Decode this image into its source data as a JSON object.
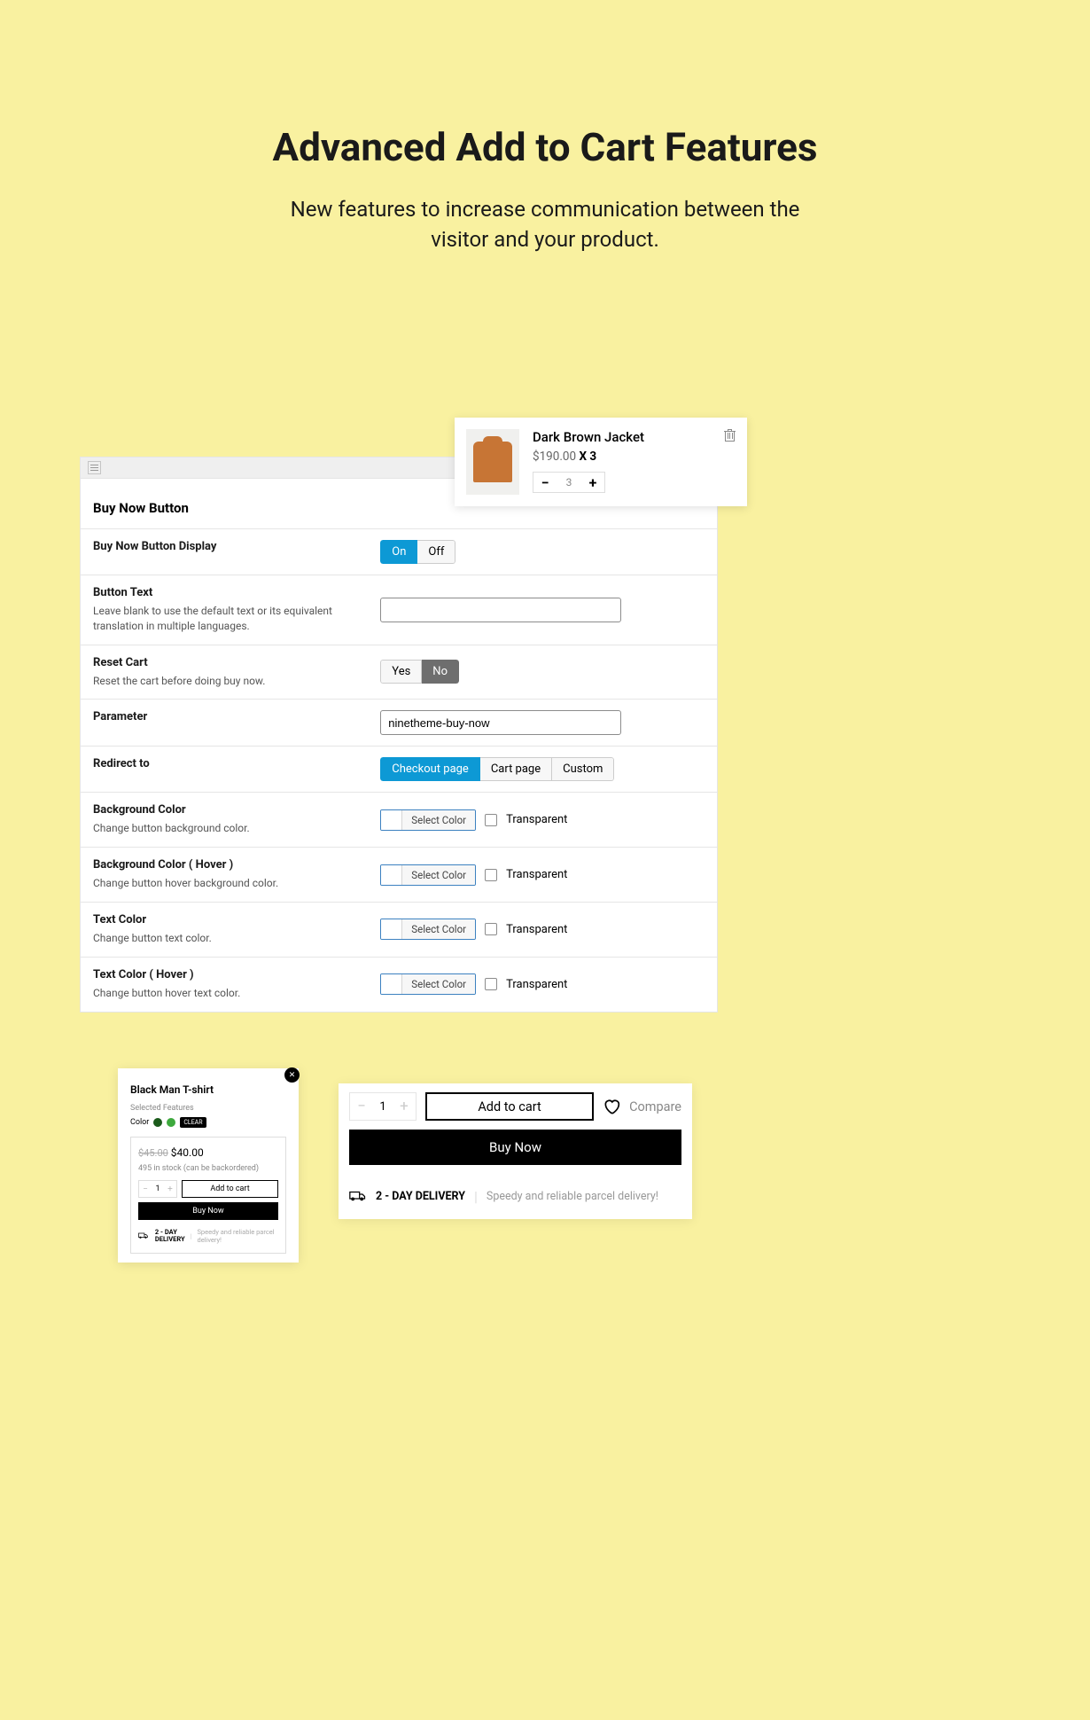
{
  "hero": {
    "title": "Advanced Add to Cart Features",
    "subtitle_l1": "New features to increase communication between the",
    "subtitle_l2": "visitor and your product."
  },
  "settings": {
    "section_title": "Buy Now Button",
    "display": {
      "label": "Buy Now Button Display",
      "on": "On",
      "off": "Off"
    },
    "button_text": {
      "label": "Button Text",
      "help": "Leave blank to use the default text or its equivalent translation in multiple languages.",
      "value": ""
    },
    "reset_cart": {
      "label": "Reset Cart",
      "help": "Reset the cart before doing buy now.",
      "yes": "Yes",
      "no": "No"
    },
    "parameter": {
      "label": "Parameter",
      "value": "ninetheme-buy-now"
    },
    "redirect": {
      "label": "Redirect to",
      "opts": [
        "Checkout page",
        "Cart page",
        "Custom"
      ]
    },
    "bg_color": {
      "label": "Background Color",
      "help": "Change button background color.",
      "select": "Select Color",
      "transparent": "Transparent"
    },
    "bg_hover": {
      "label": "Background Color ( Hover )",
      "help": "Change button hover background color.",
      "select": "Select Color",
      "transparent": "Transparent"
    },
    "text_color": {
      "label": "Text Color",
      "help": "Change button text color.",
      "select": "Select Color",
      "transparent": "Transparent"
    },
    "text_hover": {
      "label": "Text Color ( Hover )",
      "help": "Change button hover text color.",
      "select": "Select Color",
      "transparent": "Transparent"
    }
  },
  "cart_popup": {
    "name": "Dark Brown Jacket",
    "price": "$190.00",
    "multiply": "X 3",
    "qty": "3"
  },
  "product_card": {
    "title": "Black Man T-shirt",
    "selected": "Selected Features",
    "color_label": "Color",
    "clear": "CLEAR",
    "old_price": "$45.00",
    "price": "$40.00",
    "stock": "495 in stock (can be backordered)",
    "qty": "1",
    "add_to_cart": "Add to cart",
    "buy_now": "Buy Now",
    "delivery_title_l1": "2 - DAY",
    "delivery_title_l2": "DELIVERY",
    "delivery_text": "Speedy and reliable parcel delivery!"
  },
  "checkout": {
    "qty": "1",
    "add_to_cart": "Add to cart",
    "compare": "Compare",
    "buy_now": "Buy Now",
    "delivery_title": "2 - DAY DELIVERY",
    "delivery_text": "Speedy and reliable parcel delivery!"
  }
}
